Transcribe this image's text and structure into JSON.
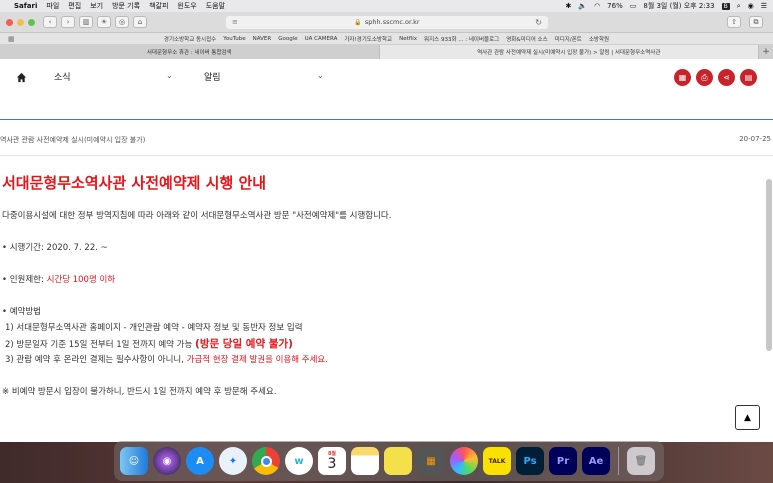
{
  "menubar": {
    "app": "Safari",
    "items": [
      "파일",
      "편집",
      "보기",
      "방문 기록",
      "책갈피",
      "윈도우",
      "도움말"
    ],
    "battery": "76%",
    "clock": "8월 3일 (월) 오후 2:33"
  },
  "toolbar": {
    "url": "sphh.sscmc.or.kr"
  },
  "favorites": [
    "경기소방학교 동시접수",
    "YouTube",
    "NAVER",
    "Google",
    "UA CAMERA",
    "가자!경기도소방학교",
    "Netflix",
    "뭐지스 933화 ... : 네이버블로그",
    "영화&미디어 소스",
    "미디지/폰트",
    "소방학원"
  ],
  "tabs": [
    {
      "label": "서대문형무소 휴관 : 네이버 통합검색"
    },
    {
      "label": "역사관 관람 사전예약제 실시(미예약시 입장 불가) > 알림 | 서대문형무소역사관"
    }
  ],
  "nav": {
    "section": "소식",
    "subsection": "알림"
  },
  "post": {
    "breadcrumb": "역사관 관람 사전예약제 실시(미예약시 입장 불가)",
    "date": "20-07-25",
    "title": "서대문형무소역사관 사전예약제 시행 안내",
    "intro": "다중이용시설에 대한 정부 방역지침에 따라 아래와 같이 서대문형무소역사관 방문 \"사전예약제\"를 시행합니다.",
    "period": "• 시행기간: 2020. 7. 22. ~",
    "limit_label": "• 인원제한: ",
    "limit_value": "시간당 100명 이하",
    "method_label": "• 예약방법",
    "step1": "1) 서대문형무소역사관 홈페이지 - 개인관람 예약 - 예약자 정보 및 동반자 정보 입력",
    "step2_text": "2) 방문일자 기준 15일 전부터 1일 전까지 예약 가능",
    "step2_emph": "(방문 당일 예약 불가)",
    "step3_text": "3) 관람 예약 후 온라인 결제는 필수사항이 아니니, ",
    "step3_emph": "가급적 현장 결제 발권을 이용해 주세요.",
    "note": "※ 비예약 방문시 입장이 불가하니, 반드시 1일 전까지 예약 후 방문해 주세요."
  },
  "dock": [
    "Finder",
    "Siri",
    "App Store",
    "Safari",
    "Chrome",
    "Whale",
    "Calendar",
    "Notes",
    "Stickies",
    "Calculator",
    "Photos",
    "KakaoTalk",
    "Photoshop",
    "Premiere",
    "After Effects",
    "Trash"
  ],
  "dock_labels": {
    "calendar_month": "8월",
    "calendar_day": "3",
    "kakao": "TALK",
    "ps": "Ps",
    "pr": "Pr",
    "ae": "Ae"
  },
  "colors": {
    "accent_red": "#e8141a",
    "circle_red": "#c8232c",
    "nav_blue": "#3c79b5"
  }
}
